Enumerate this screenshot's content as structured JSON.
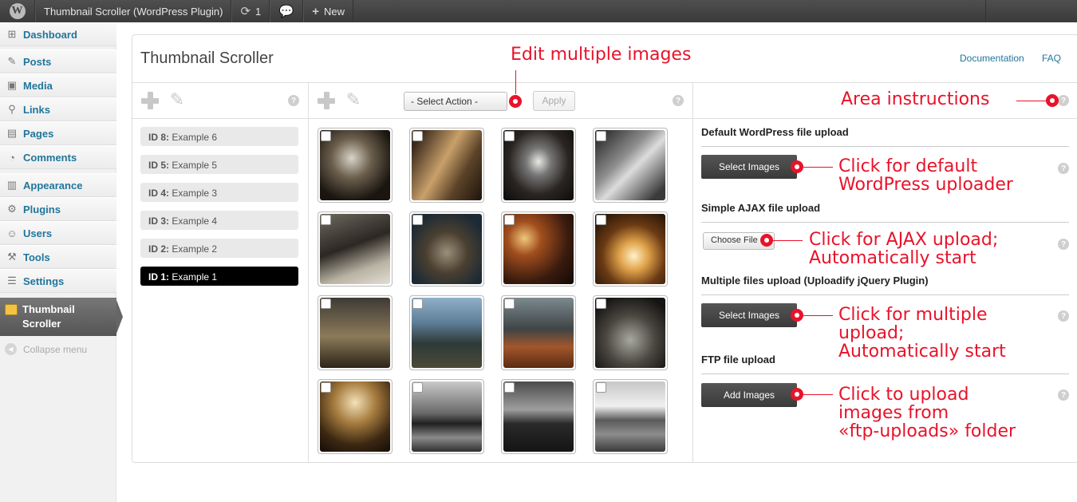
{
  "admin_bar": {
    "site_name": "Thumbnail Scroller (WordPress Plugin)",
    "updates_count": "1",
    "new_label": "New"
  },
  "admin_menu": {
    "items": [
      {
        "label": "Dashboard",
        "icon": "dashboard-icon"
      },
      {
        "label": "Posts",
        "icon": "pin-icon"
      },
      {
        "label": "Media",
        "icon": "media-icon"
      },
      {
        "label": "Links",
        "icon": "links-icon"
      },
      {
        "label": "Pages",
        "icon": "pages-icon"
      },
      {
        "label": "Comments",
        "icon": "comments-icon"
      },
      {
        "label": "Appearance",
        "icon": "appearance-icon"
      },
      {
        "label": "Plugins",
        "icon": "plugins-icon"
      },
      {
        "label": "Users",
        "icon": "users-icon"
      },
      {
        "label": "Tools",
        "icon": "tools-icon"
      },
      {
        "label": "Settings",
        "icon": "settings-icon"
      }
    ],
    "current_line1": "Thumbnail",
    "current_line2": "Scroller",
    "collapse_label": "Collapse menu"
  },
  "page": {
    "title": "Thumbnail Scroller",
    "documentation_link": "Documentation",
    "faq_link": "FAQ"
  },
  "sliders": [
    {
      "id": "ID 8:",
      "name": "Example 6",
      "active": false
    },
    {
      "id": "ID 5:",
      "name": "Example 5",
      "active": false
    },
    {
      "id": "ID 4:",
      "name": "Example 3",
      "active": false
    },
    {
      "id": "ID 3:",
      "name": "Example 4",
      "active": false
    },
    {
      "id": "ID 2:",
      "name": "Example 2",
      "active": false
    },
    {
      "id": "ID 1:",
      "name": "Example 1",
      "active": true
    }
  ],
  "images_toolbar": {
    "select_action": "- Select Action -",
    "apply_label": "Apply"
  },
  "upload": {
    "default_title": "Default WordPress file upload",
    "default_button": "Select Images",
    "ajax_title": "Simple AJAX file upload",
    "ajax_button": "Choose File",
    "multiple_title": "Multiple files upload (Uploadify jQuery Plugin)",
    "multiple_button": "Select Images",
    "ftp_title": "FTP file upload",
    "ftp_button": "Add Images"
  },
  "annotations": {
    "edit_multiple": "Edit multiple images",
    "area_instructions": "Area instructions",
    "default_line1": "Click for default",
    "default_line2": "WordPress uploader",
    "ajax_line1": "Click for AJAX upload;",
    "ajax_line2": "Automatically start",
    "multiple_line1": "Click for multiple",
    "multiple_line2": "upload;",
    "multiple_line3": "Automatically start",
    "ftp_line1": "Click to upload",
    "ftp_line2": "images from",
    "ftp_line3": "«ftp-uploads» folder"
  },
  "colors": {
    "annotation_red": "#e8132a",
    "link_blue": "#21759b",
    "admin_bar": "#464646"
  }
}
